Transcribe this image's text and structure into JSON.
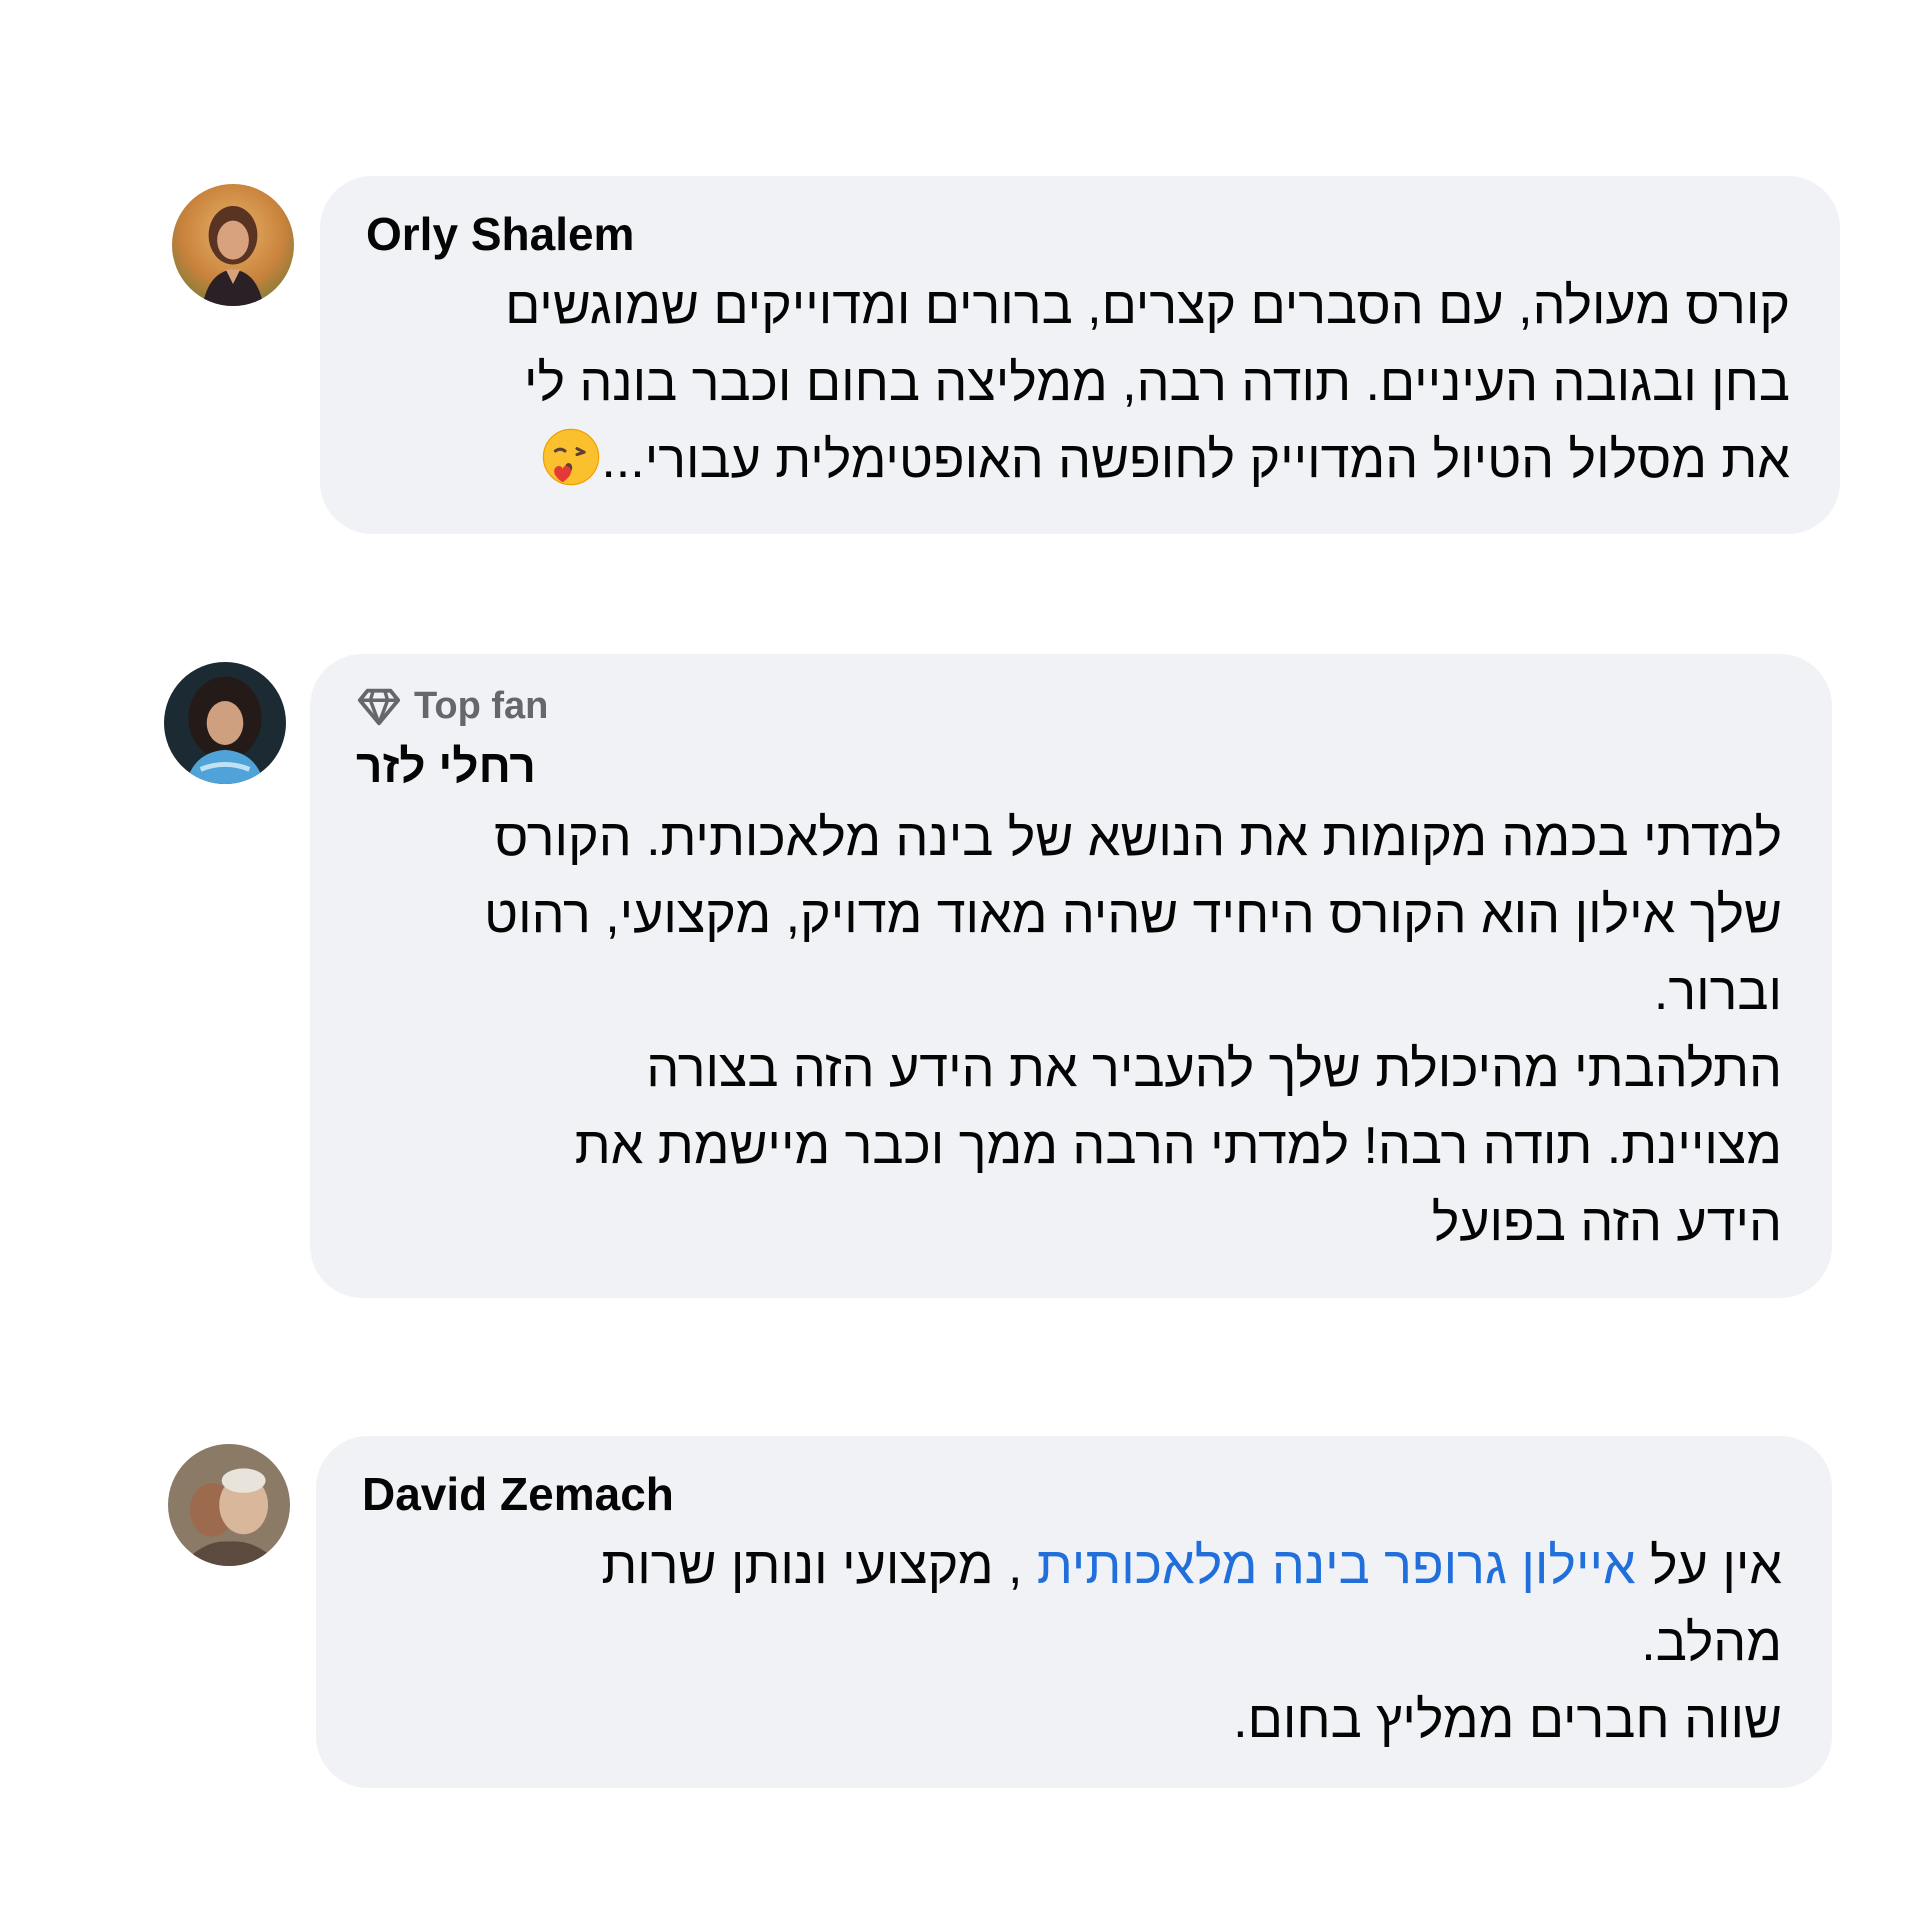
{
  "comments": [
    {
      "author": "Orly Shalem",
      "avatar_icon": "profile-photo-orly",
      "lines": [
        "קורס מעולה, עם הסברים קצרים, ברורים ומדוייקים שמוגשים",
        "בחן ובגובה העיניים. תודה רבה, ממליצה בחום וכבר בונה לי",
        "את מסלול הטיול המדוייק לחופשה האופטימלית עבורי..."
      ],
      "emoji_icon": "face-blowing-kiss-emoji"
    },
    {
      "badge": "Top fan",
      "badge_icon": "diamond-icon",
      "author": "רחלי לזר",
      "avatar_icon": "profile-photo-racheli",
      "lines": [
        "למדתי בכמה מקומות את הנושא של בינה מלאכותית. הקורס",
        "שלך אילון הוא הקורס היחיד שהיה מאוד מדויק, מקצועי, רהוט",
        "וברור.",
        "התלהבתי מהיכולת שלך להעביר את הידע הזה בצורה",
        "מצויינת. תודה רבה! למדתי הרבה ממך וכבר מיישמת את",
        "הידע הזה בפועל"
      ]
    },
    {
      "author": "David Zemach",
      "avatar_icon": "profile-photo-david",
      "line1_prefix": "אין על ",
      "mention": "איילון גרופר בינה מלאכותית",
      "line1_suffix": " , מקצועי ונותן שרות",
      "lines_after": [
        "מהלב.",
        "שווה חברים ממליץ בחום."
      ]
    }
  ],
  "colors": {
    "bubble": "#f0f2f5",
    "text": "#050505",
    "secondary": "#65676b",
    "mention": "#216fdb"
  }
}
